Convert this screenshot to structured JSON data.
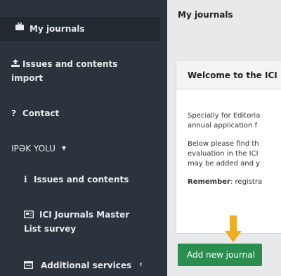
{
  "sidebar": {
    "items": [
      {
        "label": "My journals",
        "icon": "briefcase-icon"
      },
      {
        "label_line1": "Issues and contents",
        "label_line2": "import",
        "icon": "import-icon"
      },
      {
        "label": "Contact",
        "icon": "question-icon"
      },
      {
        "label": "IPƏK YOLU",
        "caret": "▾"
      },
      {
        "label": "Issues and contents",
        "icon": "info-icon"
      },
      {
        "label_line1": "ICI Journals Master",
        "label_line2": "List survey",
        "icon": "id-card-icon"
      },
      {
        "label": "Additional services",
        "icon": "window-icon",
        "expand": "‹"
      }
    ]
  },
  "main": {
    "page_title": "My journals",
    "panel": {
      "title": "Welcome to the ICI",
      "p1_line1": "Specially for Editoria",
      "p1_line2": "annual application f",
      "p2_line1": "Below please find th",
      "p2_line2": "evaluation in the ICI",
      "p2_line3": "may be added and y",
      "p3_bold": "Remember",
      "p3_rest": ": registra"
    },
    "add_button_label": "Add new journal"
  },
  "colors": {
    "sidebar": "#2b333c",
    "accent_green": "#2a8e4f",
    "arrow": "#f0ab1f"
  }
}
